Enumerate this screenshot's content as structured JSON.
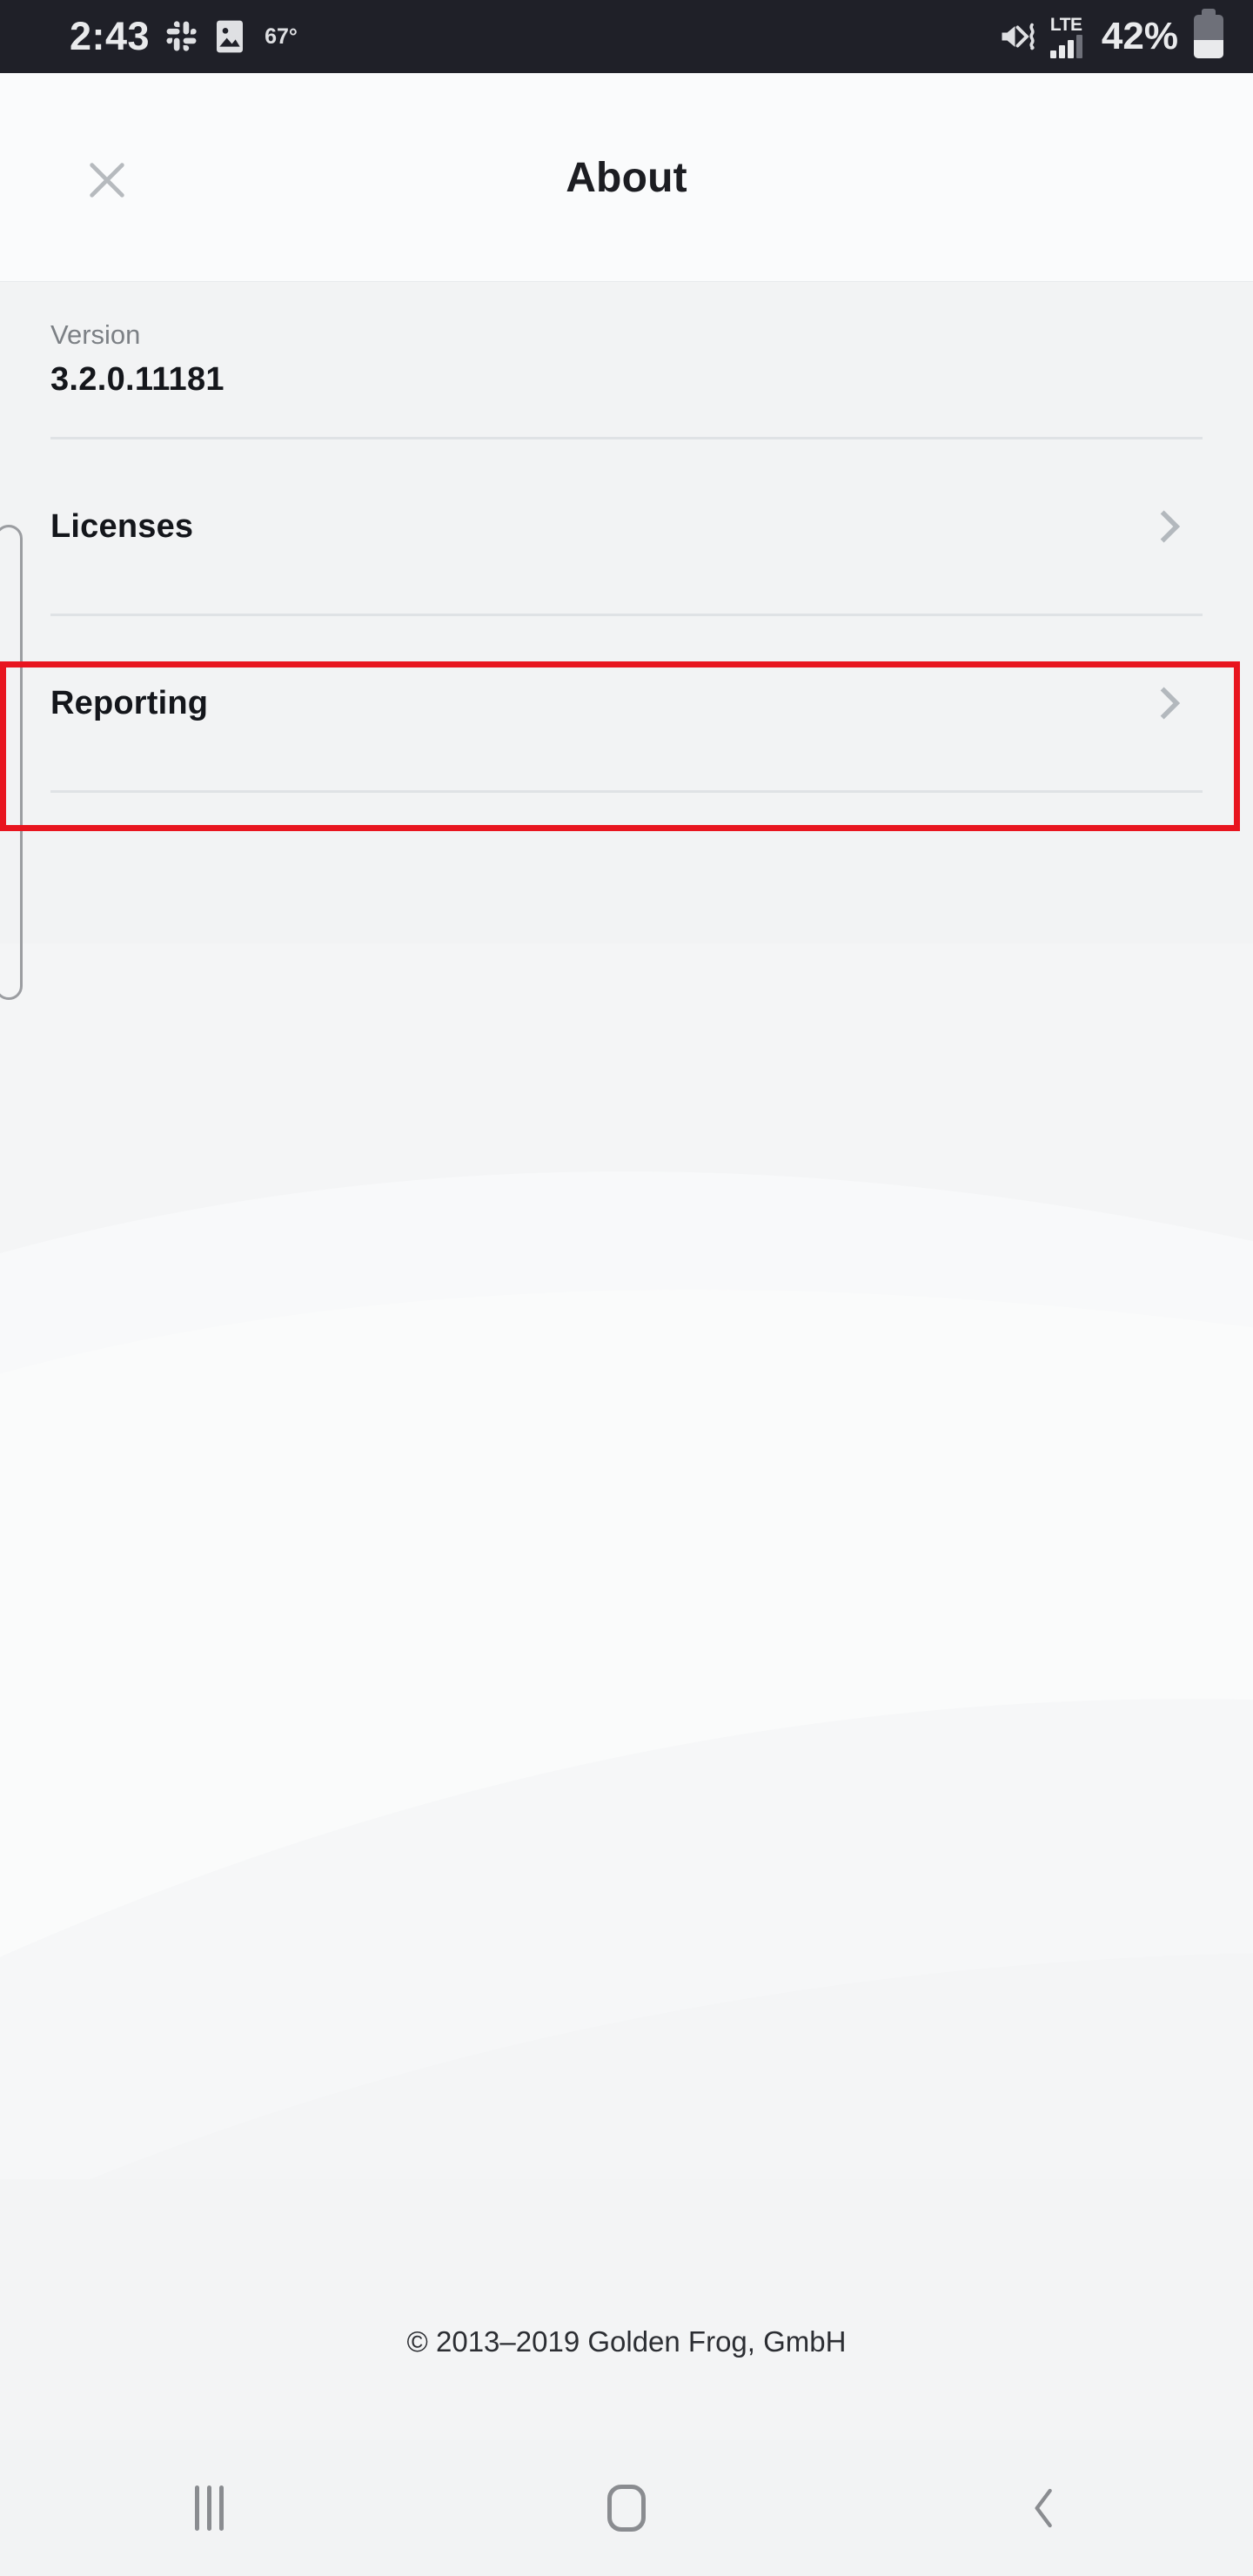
{
  "status_bar": {
    "clock": "2:43",
    "temperature": "67°",
    "network_type": "LTE",
    "battery_percent": "42%",
    "icons": [
      "slack-icon",
      "photo-icon",
      "mute-vibrate-icon",
      "signal-bars-icon",
      "battery-icon"
    ],
    "background_color": "#1f2028",
    "foreground_color": "#e9eaec"
  },
  "header": {
    "title": "About",
    "close_label": "Close",
    "background_color": "#fafbfc"
  },
  "content": {
    "version": {
      "label": "Version",
      "value": "3.2.0.11181"
    },
    "rows": [
      {
        "label": "Licenses",
        "chevron": "chevron-right-icon",
        "highlighted": false
      },
      {
        "label": "Reporting",
        "chevron": "chevron-right-icon",
        "highlighted": true
      }
    ],
    "highlight_color": "#e8151f",
    "background_color": "#f2f3f4"
  },
  "footer": {
    "copyright": "© 2013–2019 Golden Frog, GmbH"
  },
  "nav_bar": {
    "buttons": [
      {
        "name": "recents",
        "icon": "recents-icon"
      },
      {
        "name": "home",
        "icon": "home-icon"
      },
      {
        "name": "back",
        "icon": "back-chevron-icon"
      }
    ]
  }
}
